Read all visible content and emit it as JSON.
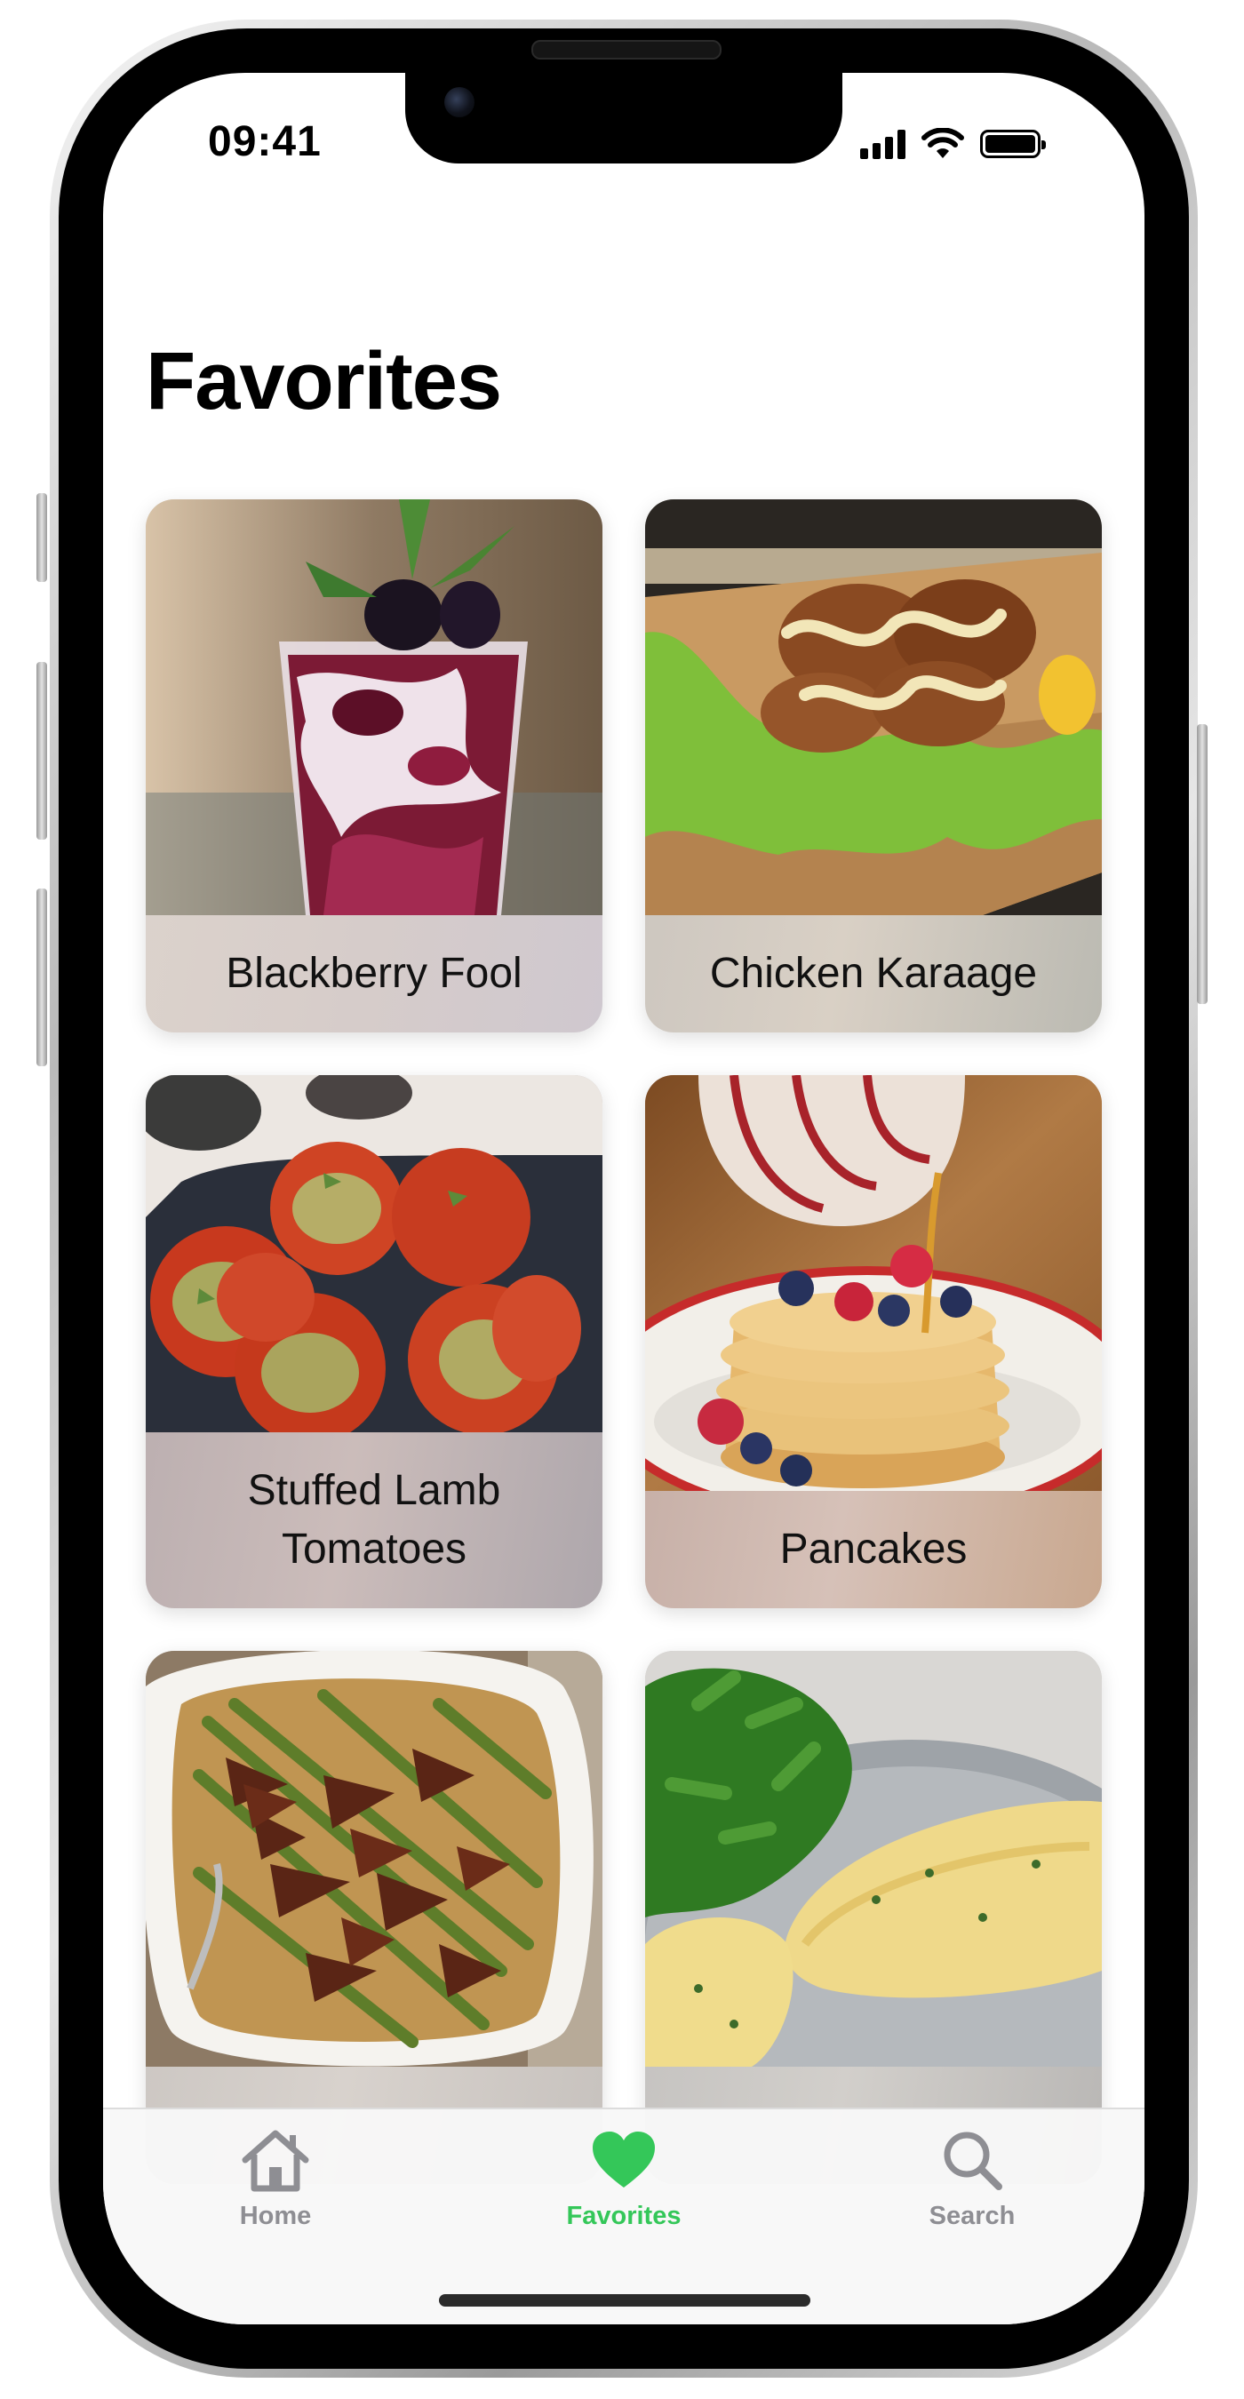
{
  "status_bar": {
    "time": "09:41"
  },
  "page": {
    "title": "Favorites"
  },
  "recipes": [
    {
      "name": "Blackberry Fool",
      "photo": "blackberry-fool-photo"
    },
    {
      "name": "Chicken Karaage",
      "photo": "chicken-karaage-photo"
    },
    {
      "name": "Stuffed Lamb Tomatoes",
      "photo": "stuffed-lamb-tomatoes-photo"
    },
    {
      "name": "Pancakes",
      "photo": "pancakes-photo"
    },
    {
      "name": "",
      "photo": "beef-asparagus-noodles-photo"
    },
    {
      "name": "",
      "photo": "omelette-greens-photo"
    }
  ],
  "tab_bar": {
    "tabs": [
      {
        "label": "Home",
        "icon": "house-icon",
        "selected": false
      },
      {
        "label": "Favorites",
        "icon": "heart-icon",
        "selected": true
      },
      {
        "label": "Search",
        "icon": "magnifier-icon",
        "selected": false
      }
    ],
    "accent_color": "#34c759",
    "inactive_color": "#8e8e93"
  }
}
